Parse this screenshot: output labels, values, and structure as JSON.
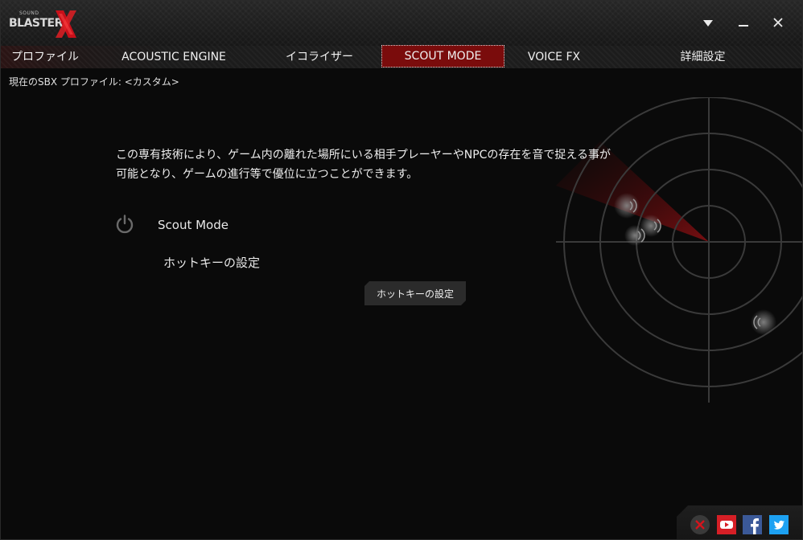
{
  "app": {
    "logo_small": "SOUND",
    "logo_text": "BLASTER",
    "logo_x": "X"
  },
  "window_controls": {
    "menu_icon": "dropdown-arrow-icon",
    "minimize_icon": "minimize-icon",
    "close_icon": "close-icon"
  },
  "tabs": [
    {
      "label": "プロファイル",
      "active": false
    },
    {
      "label": "ACOUSTIC ENGINE",
      "active": false
    },
    {
      "label": "イコライザー",
      "active": false
    },
    {
      "label": "SCOUT MODE",
      "active": true
    },
    {
      "label": "VOICE FX",
      "active": false
    },
    {
      "label": "詳細設定",
      "active": false
    }
  ],
  "profile": {
    "current": "現在のSBX プロファイル: <カスタム>"
  },
  "scout": {
    "description_line1": "この専有技術により、ゲーム内の離れた場所にいる相手プレーヤーやNPCの存在を音で捉える事が",
    "description_line2": "可能となり、ゲームの進行等で優位に立つことができます。",
    "mode_label": "Scout Mode",
    "hotkey_label": "ホットキーの設定",
    "hotkey_button": "ホットキーの設定"
  },
  "social": {
    "icons": [
      "creative-x-icon",
      "youtube-icon",
      "facebook-icon",
      "twitter-icon"
    ]
  },
  "colors": {
    "accent": "#7a0c0c",
    "background": "#0a0a0a",
    "youtube": "#d61f26",
    "facebook": "#3b5998",
    "twitter": "#1da1f2"
  }
}
